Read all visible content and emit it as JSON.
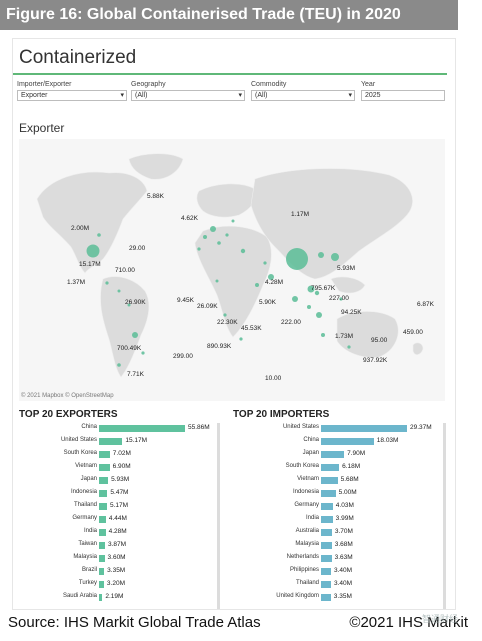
{
  "banner": {
    "title": "Figure 16: Global Containerised Trade (TEU) in 2020"
  },
  "dashboard": {
    "title": "Containerized",
    "filters": [
      {
        "label": "Importer/Exporter",
        "value": "Exporter"
      },
      {
        "label": "Geography",
        "value": "(All)"
      },
      {
        "label": "Commodity",
        "value": "(All)"
      },
      {
        "label": "Year",
        "value": "2025"
      }
    ],
    "map_title": "Exporter",
    "map_copyright": "© 2021 Mapbox © OpenStreetMap",
    "map_labels": [
      "5.88K",
      "4.62K",
      "1.17M",
      "2.00M",
      "29.00",
      "15.17M",
      "710.00",
      "1.37M",
      "5.93M",
      "4.28M",
      "795.67K",
      "227.00",
      "6.87K",
      "94.25K",
      "26.90K",
      "9.45K",
      "26.09K",
      "5.90K",
      "22.30K",
      "45.53K",
      "222.00",
      "1.73M",
      "95.00",
      "459.00",
      "700.49K",
      "890.93K",
      "937.92K",
      "299.00",
      "7.71K",
      "10.00"
    ],
    "map_accent": "#5fbf9a"
  },
  "exporters": {
    "title": "TOP 20 EXPORTERS",
    "color": "#5fc29e",
    "max": 55.86,
    "rows": [
      {
        "name": "China",
        "value": 55.86,
        "label": "55.86M"
      },
      {
        "name": "United States",
        "value": 15.17,
        "label": "15.17M"
      },
      {
        "name": "South Korea",
        "value": 7.02,
        "label": "7.02M"
      },
      {
        "name": "Vietnam",
        "value": 6.9,
        "label": "6.90M"
      },
      {
        "name": "Japan",
        "value": 5.93,
        "label": "5.93M"
      },
      {
        "name": "Indonesia",
        "value": 5.47,
        "label": "5.47M"
      },
      {
        "name": "Thailand",
        "value": 5.17,
        "label": "5.17M"
      },
      {
        "name": "Germany",
        "value": 4.44,
        "label": "4.44M"
      },
      {
        "name": "India",
        "value": 4.28,
        "label": "4.28M"
      },
      {
        "name": "Taiwan",
        "value": 3.87,
        "label": "3.87M"
      },
      {
        "name": "Malaysia",
        "value": 3.6,
        "label": "3.60M"
      },
      {
        "name": "Brazil",
        "value": 3.35,
        "label": "3.35M"
      },
      {
        "name": "Turkey",
        "value": 3.2,
        "label": "3.20M"
      },
      {
        "name": "Saudi Arabia",
        "value": 2.19,
        "label": "2.19M"
      }
    ]
  },
  "importers": {
    "title": "TOP 20 IMPORTERS",
    "color": "#6cb6cc",
    "max": 29.37,
    "rows": [
      {
        "name": "United States",
        "value": 29.37,
        "label": "29.37M"
      },
      {
        "name": "China",
        "value": 18.03,
        "label": "18.03M"
      },
      {
        "name": "Japan",
        "value": 7.9,
        "label": "7.90M"
      },
      {
        "name": "South Korea",
        "value": 6.18,
        "label": "6.18M"
      },
      {
        "name": "Vietnam",
        "value": 5.68,
        "label": "5.68M"
      },
      {
        "name": "Indonesia",
        "value": 5.0,
        "label": "5.00M"
      },
      {
        "name": "Germany",
        "value": 4.03,
        "label": "4.03M"
      },
      {
        "name": "India",
        "value": 3.99,
        "label": "3.99M"
      },
      {
        "name": "Australia",
        "value": 3.7,
        "label": "3.70M"
      },
      {
        "name": "Malaysia",
        "value": 3.68,
        "label": "3.68M"
      },
      {
        "name": "Netherlands",
        "value": 3.63,
        "label": "3.63M"
      },
      {
        "name": "Philippines",
        "value": 3.4,
        "label": "3.40M"
      },
      {
        "name": "Thailand",
        "value": 3.4,
        "label": "3.40M"
      },
      {
        "name": "United Kingdom",
        "value": 3.35,
        "label": "3.35M"
      }
    ]
  },
  "footer": {
    "source": "Source: IHS Markit Global Trade Atlas",
    "copyright": "©2021 IHS Markit",
    "watermark": "智通财经"
  }
}
